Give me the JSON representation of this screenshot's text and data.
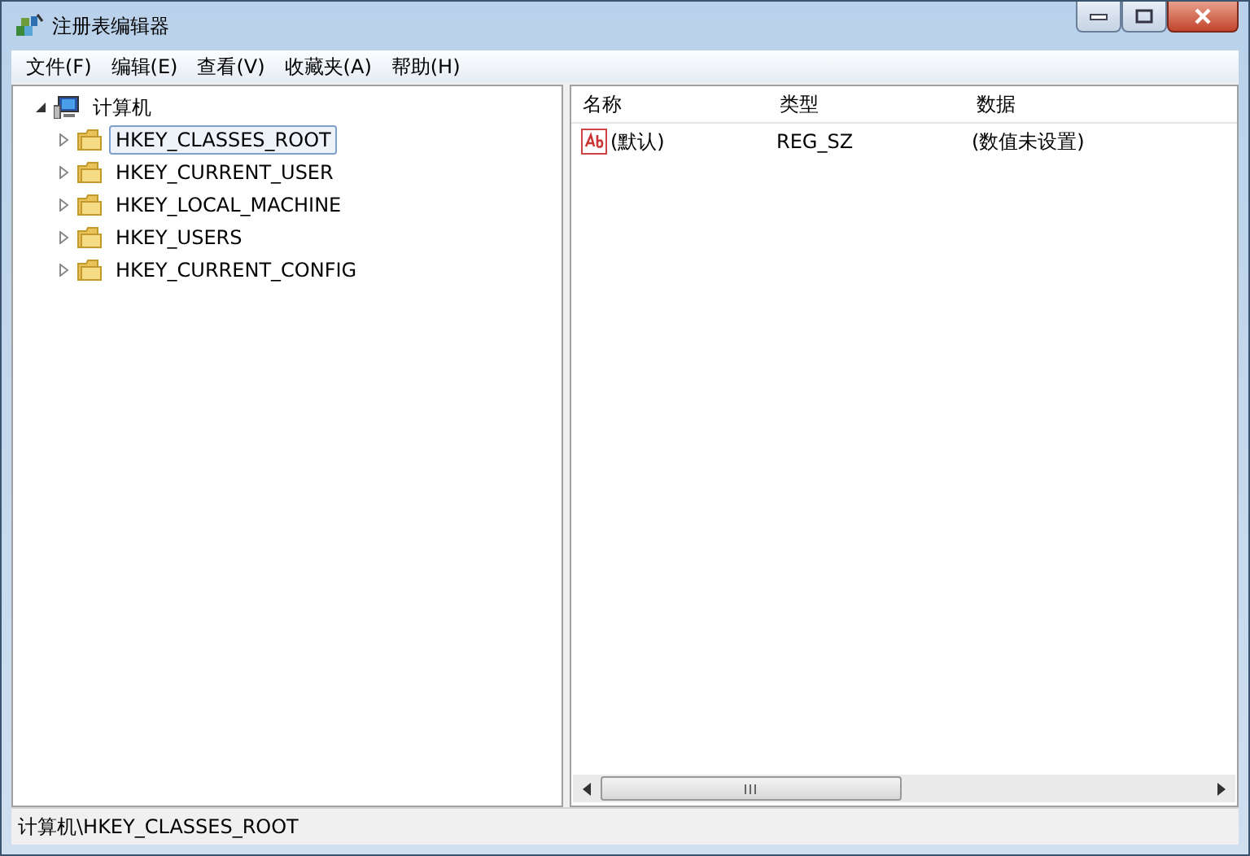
{
  "window": {
    "title": "注册表编辑器"
  },
  "menu": [
    {
      "label": "文件(F)"
    },
    {
      "label": "编辑(E)"
    },
    {
      "label": "查看(V)"
    },
    {
      "label": "收藏夹(A)"
    },
    {
      "label": "帮助(H)"
    }
  ],
  "tree": {
    "label": "计算机",
    "expanded": true,
    "children": [
      {
        "label": "HKEY_CLASSES_ROOT",
        "selected": true,
        "expanded": false
      },
      {
        "label": "HKEY_CURRENT_USER",
        "selected": false,
        "expanded": false
      },
      {
        "label": "HKEY_LOCAL_MACHINE",
        "selected": false,
        "expanded": false
      },
      {
        "label": "HKEY_USERS",
        "selected": false,
        "expanded": false
      },
      {
        "label": "HKEY_CURRENT_CONFIG",
        "selected": false,
        "expanded": false
      }
    ]
  },
  "table": {
    "columns": [
      "名称",
      "类型",
      "数据"
    ],
    "rows": [
      [
        "(默认)",
        "REG_SZ",
        "(数值未设置)"
      ]
    ]
  },
  "status_bar": "计算机\\HKEY_CLASSES_ROOT"
}
